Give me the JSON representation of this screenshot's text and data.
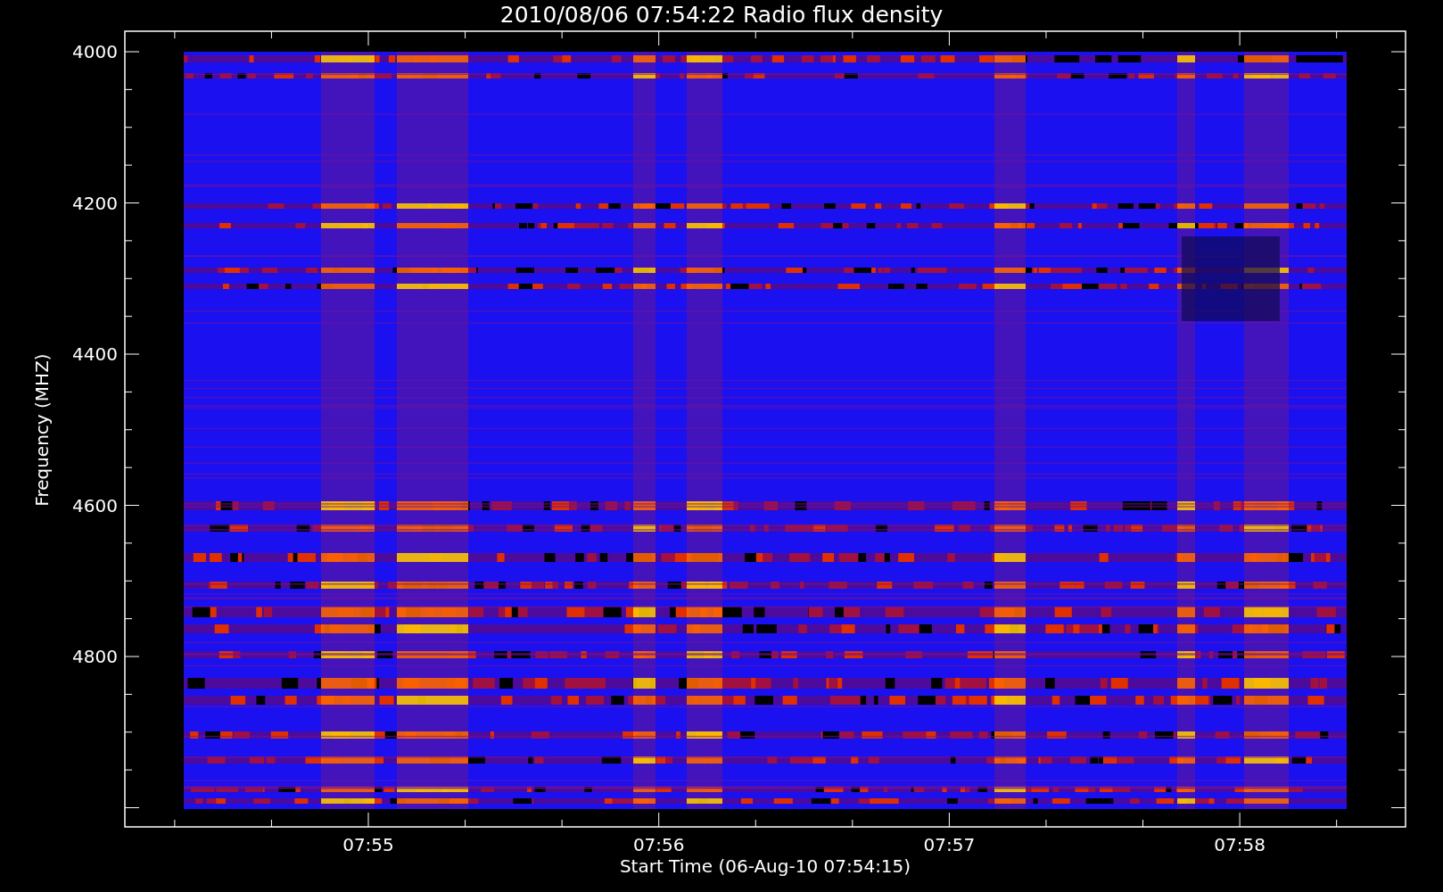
{
  "title": "2010/08/06 07:54:22 Radio flux density",
  "y_axis": {
    "label": "Frequency (MHZ)",
    "ticks": [
      "4000",
      "4200",
      "4400",
      "4600",
      "4800"
    ]
  },
  "x_axis": {
    "label": "Start Time (06-Aug-10 07:54:15)",
    "ticks": [
      "07:55",
      "07:56",
      "07:57",
      "07:58"
    ]
  }
}
